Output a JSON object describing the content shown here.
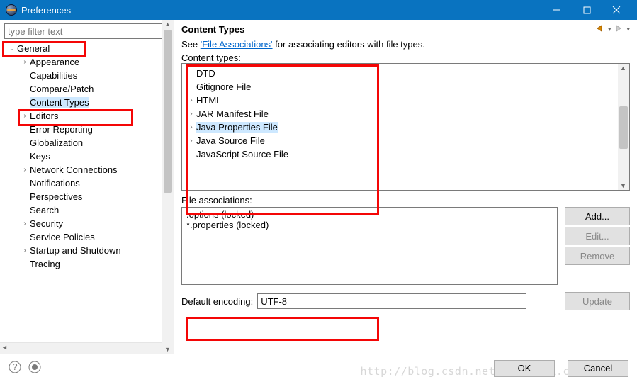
{
  "window": {
    "title": "Preferences"
  },
  "filter": {
    "placeholder": "type filter text"
  },
  "tree": [
    {
      "label": "General",
      "depth": 0,
      "arrow": "down"
    },
    {
      "label": "Appearance",
      "depth": 1,
      "arrow": "right"
    },
    {
      "label": "Capabilities",
      "depth": 1,
      "arrow": ""
    },
    {
      "label": "Compare/Patch",
      "depth": 1,
      "arrow": ""
    },
    {
      "label": "Content Types",
      "depth": 1,
      "arrow": "",
      "selected": true
    },
    {
      "label": "Editors",
      "depth": 1,
      "arrow": "right"
    },
    {
      "label": "Error Reporting",
      "depth": 1,
      "arrow": ""
    },
    {
      "label": "Globalization",
      "depth": 1,
      "arrow": ""
    },
    {
      "label": "Keys",
      "depth": 1,
      "arrow": ""
    },
    {
      "label": "Network Connections",
      "depth": 1,
      "arrow": "right"
    },
    {
      "label": "Notifications",
      "depth": 1,
      "arrow": ""
    },
    {
      "label": "Perspectives",
      "depth": 1,
      "arrow": ""
    },
    {
      "label": "Search",
      "depth": 1,
      "arrow": ""
    },
    {
      "label": "Security",
      "depth": 1,
      "arrow": "right"
    },
    {
      "label": "Service Policies",
      "depth": 1,
      "arrow": ""
    },
    {
      "label": "Startup and Shutdown",
      "depth": 1,
      "arrow": "right"
    },
    {
      "label": "Tracing",
      "depth": 1,
      "arrow": ""
    }
  ],
  "right": {
    "heading": "Content Types",
    "hint_pre": "See ",
    "hint_link": "'File Associations'",
    "hint_post": " for associating editors with file types.",
    "content_types_label": "Content types:",
    "content_types": [
      {
        "label": "DTD",
        "arrow": ""
      },
      {
        "label": "Gitignore File",
        "arrow": ""
      },
      {
        "label": "HTML",
        "arrow": "right"
      },
      {
        "label": "JAR Manifest File",
        "arrow": "right"
      },
      {
        "label": "Java Properties File",
        "arrow": "right",
        "selected": true
      },
      {
        "label": "Java Source File",
        "arrow": "right"
      },
      {
        "label": "JavaScript Source File",
        "arrow": ""
      }
    ],
    "file_assoc_label": "File associations:",
    "file_assoc": [
      ".options (locked)",
      "*.properties (locked)"
    ],
    "buttons": {
      "add": "Add...",
      "edit": "Edit...",
      "remove": "Remove",
      "update": "Update"
    },
    "encoding_label": "Default encoding:",
    "encoding_value": "UTF-8"
  },
  "footer": {
    "ok": "OK",
    "cancel": "Cancel"
  },
  "watermark": "http://blog.csdn.net/ww521111.com"
}
